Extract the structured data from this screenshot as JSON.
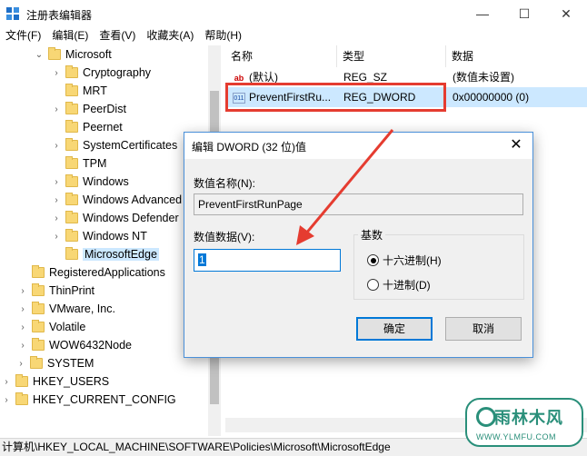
{
  "window": {
    "title": "注册表编辑器",
    "minimize_glyph": "—",
    "maximize_glyph": "☐",
    "close_glyph": "✕"
  },
  "menu": [
    "文件(F)",
    "编辑(E)",
    "查看(V)",
    "收藏夹(A)",
    "帮助(H)"
  ],
  "tree": [
    {
      "label": "Microsoft",
      "chev": "⌄",
      "indent": 1
    },
    {
      "label": "Cryptography",
      "chev": "›",
      "indent": 2
    },
    {
      "label": "MRT",
      "chev": "",
      "indent": 2
    },
    {
      "label": "PeerDist",
      "chev": "›",
      "indent": 2
    },
    {
      "label": "Peernet",
      "chev": "",
      "indent": 2
    },
    {
      "label": "SystemCertificates",
      "chev": "›",
      "indent": 2
    },
    {
      "label": "TPM",
      "chev": "",
      "indent": 2
    },
    {
      "label": "Windows",
      "chev": "›",
      "indent": 2
    },
    {
      "label": "Windows Advanced",
      "chev": "›",
      "indent": 2
    },
    {
      "label": "Windows Defender",
      "chev": "›",
      "indent": 2
    },
    {
      "label": "Windows NT",
      "chev": "›",
      "indent": 2
    },
    {
      "label": "MicrosoftEdge",
      "chev": "",
      "indent": 2,
      "selected": true
    },
    {
      "label": "RegisteredApplications",
      "chev": "",
      "indent": 0
    },
    {
      "label": "ThinPrint",
      "chev": "›",
      "indent": 0
    },
    {
      "label": "VMware, Inc.",
      "chev": "›",
      "indent": 0
    },
    {
      "label": "Volatile",
      "chev": "›",
      "indent": 0
    },
    {
      "label": "WOW6432Node",
      "chev": "›",
      "indent": 0
    },
    {
      "label": "SYSTEM",
      "chev": "›",
      "indent": -1
    },
    {
      "label": "HKEY_USERS",
      "chev": "›",
      "indent": -2
    },
    {
      "label": "HKEY_CURRENT_CONFIG",
      "chev": "›",
      "indent": -2
    }
  ],
  "list": {
    "headers": [
      "名称",
      "类型",
      "数据"
    ],
    "rows": [
      {
        "icon": "ab",
        "name": "(默认)",
        "type": "REG_SZ",
        "data": "(数值未设置)"
      },
      {
        "icon": "bin",
        "name": "PreventFirstRu...",
        "type": "REG_DWORD",
        "data": "0x00000000 (0)",
        "selected": true
      }
    ]
  },
  "dialog": {
    "title": "编辑 DWORD (32 位)值",
    "close_glyph": "✕",
    "name_label": "数值名称(N):",
    "name_value": "PreventFirstRunPage",
    "data_label": "数值数据(V):",
    "data_value": "1",
    "base_title": "基数",
    "radio_hex": "十六进制(H)",
    "radio_dec": "十进制(D)",
    "selected_base": "hex",
    "ok": "确定",
    "cancel": "取消"
  },
  "statusbar": "计算机\\HKEY_LOCAL_MACHINE\\SOFTWARE\\Policies\\Microsoft\\MicrosoftEdge",
  "watermark": {
    "text": "雨林木风",
    "url": "WWW.YLMFU.COM"
  },
  "colors": {
    "highlight_box": "#e53c30",
    "arrow": "#e53c30",
    "selection": "#cce8ff",
    "accent": "#0078d7"
  }
}
